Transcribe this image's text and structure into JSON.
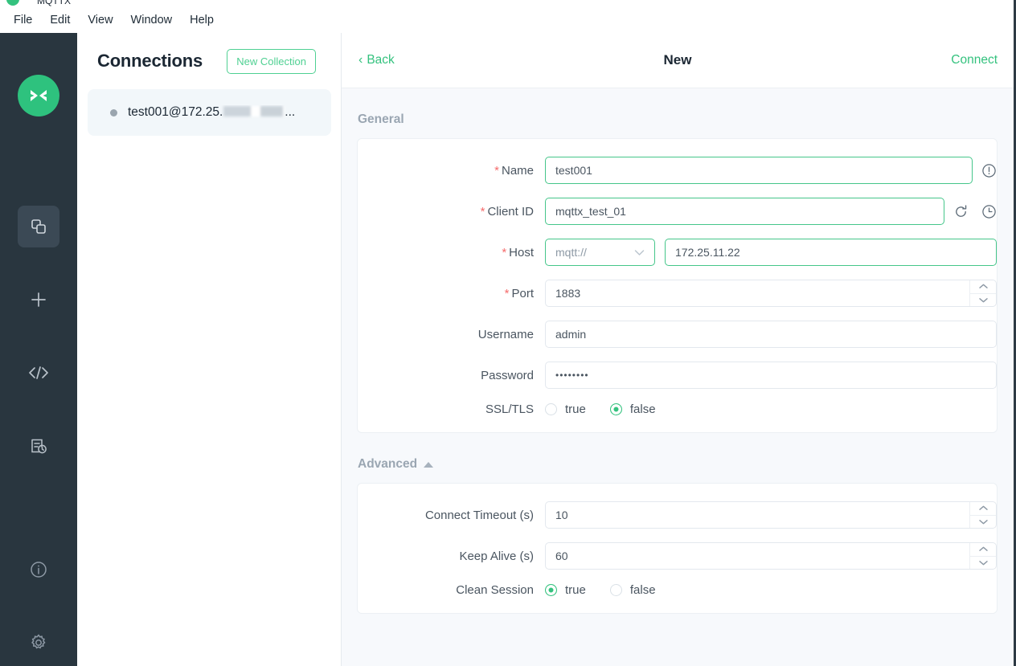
{
  "titlebar": {
    "app_name": "MQTTX"
  },
  "menubar": {
    "items": [
      "File",
      "Edit",
      "View",
      "Window",
      "Help"
    ]
  },
  "rail": {
    "logo_icon": "mqttx-logo-icon",
    "items": [
      {
        "icon": "connections-icon",
        "active": true
      },
      {
        "icon": "plus-icon",
        "active": false
      },
      {
        "icon": "code-brackets-icon",
        "active": false
      },
      {
        "icon": "script-log-icon",
        "active": false
      },
      {
        "icon": "info-circle-icon",
        "active": false
      },
      {
        "icon": "settings-gear-icon",
        "active": false
      }
    ]
  },
  "connections": {
    "title": "Connections",
    "new_collection_label": "New Collection",
    "items": [
      {
        "name": "test001@172.25.",
        "suffix": "...",
        "status": "disconnected",
        "selected": true
      }
    ]
  },
  "main": {
    "back_label": "Back",
    "title": "New",
    "connect_label": "Connect",
    "general": {
      "heading": "General",
      "fields": {
        "name_label": "Name",
        "name_value": "test001",
        "client_id_label": "Client ID",
        "client_id_value": "mqttx_test_01",
        "host_label": "Host",
        "host_protocol": "mqtt://",
        "host_value": "172.25.11.22",
        "port_label": "Port",
        "port_value": "1883",
        "username_label": "Username",
        "username_value": "admin",
        "password_label": "Password",
        "password_value": "••••••••",
        "ssl_label": "SSL/TLS",
        "ssl_true": "true",
        "ssl_false": "false",
        "ssl_selected": "false"
      },
      "icons": {
        "name_info": "info-circle-icon",
        "client_id_refresh": "refresh-icon",
        "client_id_clock": "clock-icon"
      }
    },
    "advanced": {
      "heading": "Advanced",
      "collapsed": false,
      "fields": {
        "connect_timeout_label": "Connect Timeout (s)",
        "connect_timeout_value": "10",
        "keep_alive_label": "Keep Alive (s)",
        "keep_alive_value": "60",
        "clean_session_label": "Clean Session",
        "clean_session_true": "true",
        "clean_session_false": "false",
        "clean_session_selected": "true"
      }
    }
  },
  "colors": {
    "accent_green": "#34c27e",
    "rail_dark": "#29363f",
    "page_bg": "#f7f9fc",
    "required_red": "#f56c6c"
  }
}
